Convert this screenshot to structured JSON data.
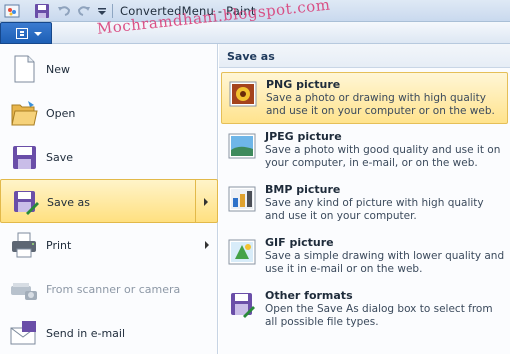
{
  "window": {
    "title": "ConvertedMenu - Paint"
  },
  "watermark": "Mochramdhani.blogspot.com",
  "quick_access": [
    "save-icon",
    "undo-icon",
    "redo-icon",
    "customize-icon"
  ],
  "app_menu": {
    "items": [
      {
        "label": "New",
        "icon": "new-document-icon",
        "enabled": true
      },
      {
        "label": "Open",
        "icon": "open-folder-icon",
        "enabled": true
      },
      {
        "label": "Save",
        "icon": "save-icon",
        "enabled": true
      },
      {
        "label": "Save as",
        "icon": "save-as-icon",
        "enabled": true,
        "selected": true,
        "has_submenu": true
      },
      {
        "label": "Print",
        "icon": "print-icon",
        "enabled": true,
        "has_submenu": true
      },
      {
        "label": "From scanner or camera",
        "icon": "scanner-icon",
        "enabled": false
      },
      {
        "label": "Send in e-mail",
        "icon": "email-icon",
        "enabled": true
      }
    ]
  },
  "submenu": {
    "header": "Save as",
    "items": [
      {
        "title": "PNG picture",
        "desc": "Save a photo or drawing with high quality and use it on your computer or on the web.",
        "icon": "png-picture-icon",
        "hover": true
      },
      {
        "title": "JPEG picture",
        "desc": "Save a photo with good quality and use it on your computer, in e-mail, or on the web.",
        "icon": "jpeg-picture-icon"
      },
      {
        "title": "BMP picture",
        "desc": "Save any kind of picture with high quality and use it on your computer.",
        "icon": "bmp-picture-icon"
      },
      {
        "title": "GIF picture",
        "desc": "Save a simple drawing with lower quality and use it in e-mail or on the web.",
        "icon": "gif-picture-icon"
      },
      {
        "title": "Other formats",
        "desc": "Open the Save As dialog box to select from all possible file types.",
        "icon": "other-formats-icon"
      }
    ]
  },
  "colors": {
    "accent": "#1d5fb5",
    "highlight": "#ffe080",
    "watermark": "#d9407a"
  }
}
